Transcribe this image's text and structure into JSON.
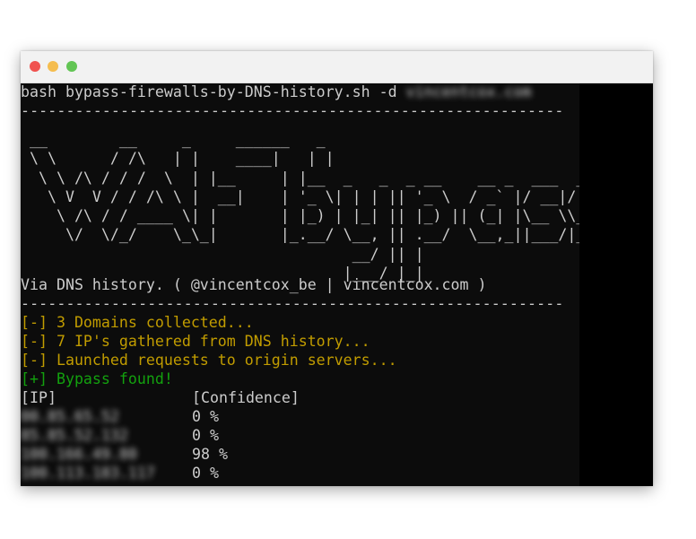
{
  "window": {
    "controls": [
      "close",
      "minimize",
      "maximize"
    ],
    "colors": {
      "close": "#f0524f",
      "minimize": "#f5bd4f",
      "maximize": "#62c554"
    }
  },
  "terminal": {
    "command": "bash bypass-firewalls-by-DNS-history.sh -d",
    "blurred_domain": "vincentcox.com",
    "separator": "------------------------------------------------------------",
    "ascii_art": " __        __     _     ______   _\n \\ \\      / /\\   | |    ____|   | |\n  \\ \\ /\\ / / /  \\  | |__     | |__  _   _  _ __    __ _  ___  ___\n   \\ V  V / / /\\ \\ |  __|    | '_ \\| | | || '_ \\  / _` |/ __|/ __|\n    \\ /\\ / / ____ \\| |       | |_) | |_| || |_) || (_| |\\__ \\\\__ \\\n     \\/  \\/_/    \\_\\_|       |_.__/ \\__, || .__/  \\__,_||___/|___/\n                                     __/ || |\n                                    |___/ |_|",
    "credit": "Via DNS history. ( @vincentcox_be | vincentcox.com )",
    "status": [
      {
        "text": "[-] 3 Domains collected...",
        "color": "#c19c00"
      },
      {
        "text": "[-] 7 IP's gathered from DNS history...",
        "color": "#c19c00"
      },
      {
        "text": "[-] Launched requests to origin servers...",
        "color": "#c19c00"
      },
      {
        "text": "[+] Bypass found!",
        "color": "#13a10e"
      }
    ],
    "table": {
      "headers": [
        "[IP]",
        "[Confidence]"
      ],
      "rows": [
        {
          "ip": "00.85.65.52",
          "confidence": "0 %"
        },
        {
          "ip": "85.85.52.132",
          "confidence": "0 %"
        },
        {
          "ip": "100.166.49.80",
          "confidence": "98 %"
        },
        {
          "ip": "100.113.183.117",
          "confidence": "0 %"
        }
      ]
    }
  }
}
